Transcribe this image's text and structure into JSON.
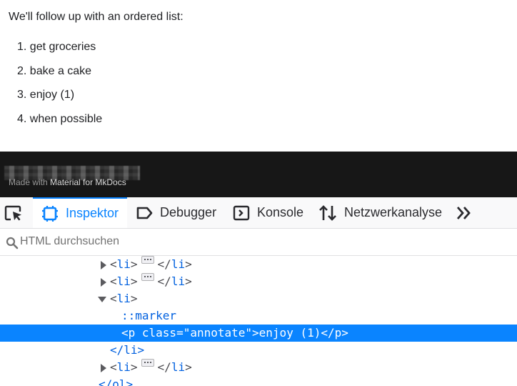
{
  "page": {
    "intro": "We'll follow up with an ordered list:",
    "list_items": [
      {
        "number": "1.",
        "text": "get groceries"
      },
      {
        "number": "2.",
        "text": "bake a cake"
      },
      {
        "number": "3.",
        "text": "enjoy (1)"
      },
      {
        "number": "4.",
        "text": "when possible"
      }
    ]
  },
  "footer": {
    "made_with": "Made with",
    "link_text": "Material for MkDocs"
  },
  "devtools": {
    "tabs": {
      "inspector": "Inspektor",
      "debugger": "Debugger",
      "console": "Konsole",
      "network": "Netzwerkanalyse"
    },
    "search": {
      "placeholder": "HTML durchsuchen"
    },
    "tree": {
      "rows": [
        {
          "kind": "collapsed-li",
          "open": "<",
          "tag": "li",
          "close": ">",
          "end_open": "</",
          "end_tag": "li",
          "end_close": ">"
        },
        {
          "kind": "collapsed-li",
          "open": "<",
          "tag": "li",
          "close": ">",
          "end_open": "</",
          "end_tag": "li",
          "end_close": ">"
        },
        {
          "kind": "expanded-li",
          "open": "<",
          "tag": "li",
          "close": ">"
        },
        {
          "kind": "pseudo",
          "text": "::marker"
        },
        {
          "kind": "selected",
          "text": "<p class=\"annotate\">enjoy (1)</p>"
        },
        {
          "kind": "closing",
          "text": "</li>"
        },
        {
          "kind": "collapsed-li",
          "open": "<",
          "tag": "li",
          "close": ">",
          "end_open": "</",
          "end_tag": "li",
          "end_close": ">"
        },
        {
          "kind": "closing-ol",
          "text": "</ol>"
        }
      ]
    },
    "colors": {
      "accent": "#0a84ff",
      "tag": "#0060df"
    }
  }
}
